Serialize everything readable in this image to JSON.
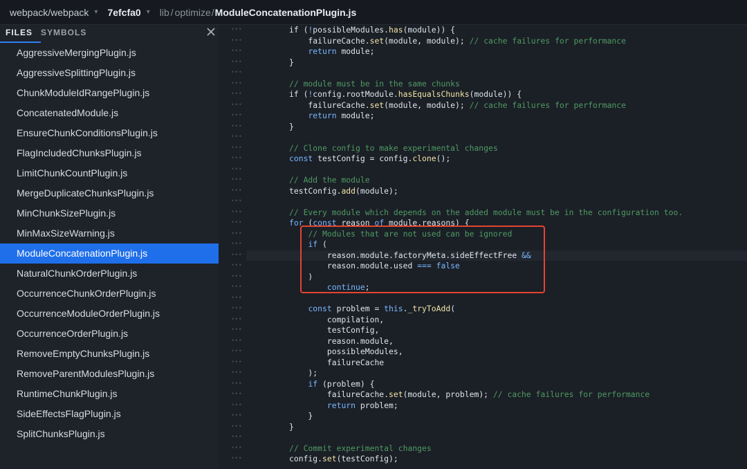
{
  "breadcrumb": {
    "repo": "webpack/webpack",
    "commit": "7efcfa0",
    "path_dir1": "lib",
    "path_dir2": "optimize",
    "file": "ModuleConcatenationPlugin.js"
  },
  "sidebar": {
    "tabs": [
      "FILES",
      "SYMBOLS"
    ],
    "files": [
      "AggressiveMergingPlugin.js",
      "AggressiveSplittingPlugin.js",
      "ChunkModuleIdRangePlugin.js",
      "ConcatenatedModule.js",
      "EnsureChunkConditionsPlugin.js",
      "FlagIncludedChunksPlugin.js",
      "LimitChunkCountPlugin.js",
      "MergeDuplicateChunksPlugin.js",
      "MinChunkSizePlugin.js",
      "MinMaxSizeWarning.js",
      "ModuleConcatenationPlugin.js",
      "NaturalChunkOrderPlugin.js",
      "OccurrenceChunkOrderPlugin.js",
      "OccurrenceModuleOrderPlugin.js",
      "OccurrenceOrderPlugin.js",
      "RemoveEmptyChunksPlugin.js",
      "RemoveParentModulesPlugin.js",
      "RuntimeChunkPlugin.js",
      "SideEffectsFlagPlugin.js",
      "SplitChunksPlugin.js"
    ],
    "active_index": 10
  },
  "editor": {
    "highlight_line": 21,
    "lines": [
      [
        [
          "",
          "if ("
        ],
        [
          "op",
          "!"
        ],
        [
          "",
          "possibleModules."
        ],
        [
          "fn",
          "has"
        ],
        [
          "",
          "(module)) {"
        ]
      ],
      [
        [
          "",
          "    failureCache."
        ],
        [
          "fn",
          "set"
        ],
        [
          "",
          "(module, module); "
        ],
        [
          "cm",
          "// cache failures for performance"
        ]
      ],
      [
        [
          "",
          "    "
        ],
        [
          "kw",
          "return"
        ],
        [
          "",
          " module;"
        ]
      ],
      [
        [
          "",
          "}"
        ]
      ],
      [],
      [
        [
          "cm",
          "// module must be in the same chunks"
        ]
      ],
      [
        [
          "",
          "if ("
        ],
        [
          "op",
          "!"
        ],
        [
          "",
          "config.rootModule."
        ],
        [
          "fn",
          "hasEqualsChunks"
        ],
        [
          "",
          "(module)) {"
        ]
      ],
      [
        [
          "",
          "    failureCache."
        ],
        [
          "fn",
          "set"
        ],
        [
          "",
          "(module, module); "
        ],
        [
          "cm",
          "// cache failures for performance"
        ]
      ],
      [
        [
          "",
          "    "
        ],
        [
          "kw",
          "return"
        ],
        [
          "",
          " module;"
        ]
      ],
      [
        [
          "",
          "}"
        ]
      ],
      [],
      [
        [
          "cm",
          "// Clone config to make experimental changes"
        ]
      ],
      [
        [
          "kw",
          "const"
        ],
        [
          "",
          " testConfig = config."
        ],
        [
          "fn",
          "clone"
        ],
        [
          "",
          "();"
        ]
      ],
      [],
      [
        [
          "cm",
          "// Add the module"
        ]
      ],
      [
        [
          "",
          "testConfig."
        ],
        [
          "fn",
          "add"
        ],
        [
          "",
          "(module);"
        ]
      ],
      [],
      [
        [
          "cm",
          "// Every module which depends on the added module must be in the configuration too."
        ]
      ],
      [
        [
          "kw",
          "for"
        ],
        [
          "",
          " ("
        ],
        [
          "kw",
          "const"
        ],
        [
          "",
          " reason "
        ],
        [
          "kw",
          "of"
        ],
        [
          "",
          " module.reasons) {"
        ]
      ],
      [
        [
          "",
          "    "
        ],
        [
          "cm",
          "// Modules that are not used can be ignored"
        ]
      ],
      [
        [
          "",
          "    "
        ],
        [
          "kw",
          "if"
        ],
        [
          "",
          " ("
        ]
      ],
      [
        [
          "",
          "        reason.module.factoryMeta.sideEffectFree "
        ],
        [
          "op",
          "&&"
        ]
      ],
      [
        [
          "",
          "        reason.module.used "
        ],
        [
          "op",
          "==="
        ],
        [
          "",
          " "
        ],
        [
          "kw",
          "false"
        ]
      ],
      [
        [
          "",
          "    )"
        ]
      ],
      [
        [
          "",
          "        "
        ],
        [
          "kw",
          "continue"
        ],
        [
          "",
          ";"
        ]
      ],
      [],
      [
        [
          "",
          "    "
        ],
        [
          "kw",
          "const"
        ],
        [
          "",
          " problem = "
        ],
        [
          "kw",
          "this"
        ],
        [
          "",
          "."
        ],
        [
          "fn",
          "_tryToAdd"
        ],
        [
          "",
          "("
        ]
      ],
      [
        [
          "",
          "        compilation,"
        ]
      ],
      [
        [
          "",
          "        testConfig,"
        ]
      ],
      [
        [
          "",
          "        reason.module,"
        ]
      ],
      [
        [
          "",
          "        possibleModules,"
        ]
      ],
      [
        [
          "",
          "        failureCache"
        ]
      ],
      [
        [
          "",
          "    );"
        ]
      ],
      [
        [
          "",
          "    "
        ],
        [
          "kw",
          "if"
        ],
        [
          "",
          " (problem) {"
        ]
      ],
      [
        [
          "",
          "        failureCache."
        ],
        [
          "fn",
          "set"
        ],
        [
          "",
          "(module, problem); "
        ],
        [
          "cm",
          "// cache failures for performance"
        ]
      ],
      [
        [
          "",
          "        "
        ],
        [
          "kw",
          "return"
        ],
        [
          "",
          " problem;"
        ]
      ],
      [
        [
          "",
          "    }"
        ]
      ],
      [
        [
          "",
          "}"
        ]
      ],
      [],
      [
        [
          "cm",
          "// Commit experimental changes"
        ]
      ],
      [
        [
          "",
          "config."
        ],
        [
          "fn",
          "set"
        ],
        [
          "",
          "(testConfig);"
        ]
      ]
    ]
  }
}
